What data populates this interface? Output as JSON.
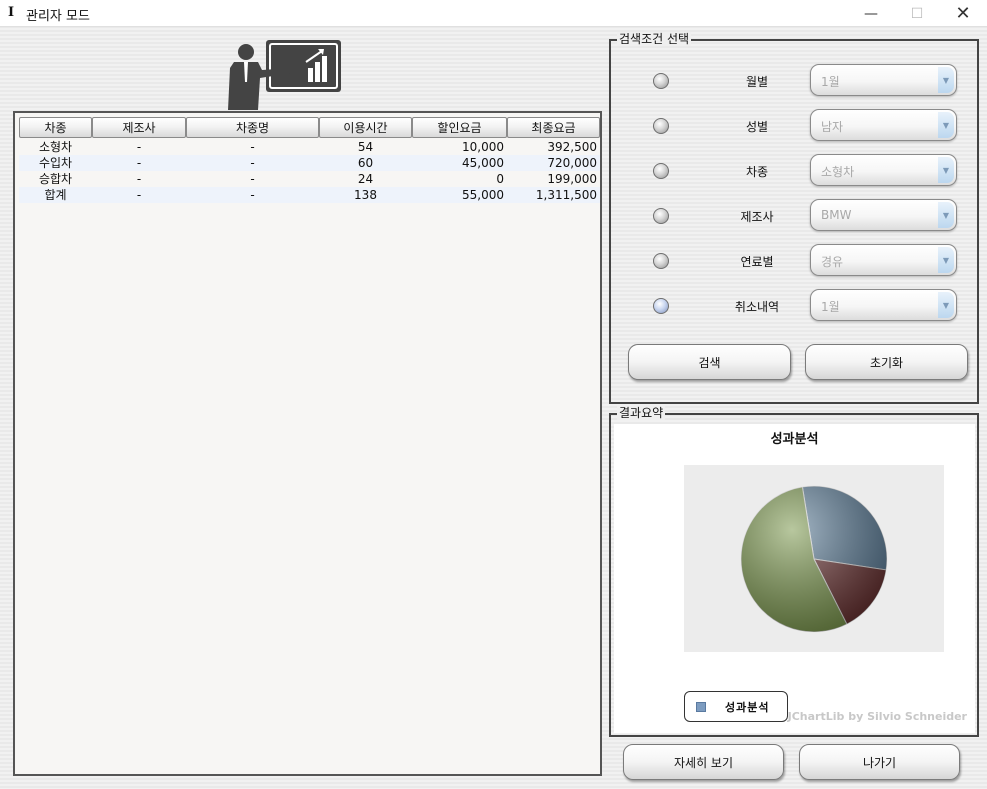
{
  "window": {
    "icon": "I",
    "title": "관리자 모드",
    "minimize_glyph": "—",
    "maximize_glyph": "☐",
    "close_glyph": "✕"
  },
  "table": {
    "headers": [
      "차종",
      "제조사",
      "차종명",
      "이용시간",
      "할인요금",
      "최종요금"
    ],
    "rows": [
      [
        "소형차",
        "-",
        "-",
        "54",
        "10,000",
        "392,500"
      ],
      [
        "수입차",
        "-",
        "-",
        "60",
        "45,000",
        "720,000"
      ],
      [
        "승합차",
        "-",
        "-",
        "24",
        "0",
        "199,000"
      ],
      [
        "합계",
        "-",
        "-",
        "138",
        "55,000",
        "1,311,500"
      ]
    ]
  },
  "search": {
    "group_label": "검색조건 선택",
    "criteria": [
      {
        "label": "월별",
        "value": "1월"
      },
      {
        "label": "성별",
        "value": "남자"
      },
      {
        "label": "차종",
        "value": "소형차"
      },
      {
        "label": "제조사",
        "value": "BMW"
      },
      {
        "label": "연료별",
        "value": "경유"
      },
      {
        "label": "취소내역",
        "value": "1월"
      }
    ],
    "selected_index": 5,
    "search_button": "검색",
    "reset_button": "초기화"
  },
  "result": {
    "group_label": "결과요약",
    "legend": "성과분석",
    "watermark": "JChartLib by Silvio Schneider"
  },
  "chart_data": {
    "type": "pie",
    "title": "성과분석",
    "slices": [
      {
        "value": 392500,
        "color": "#5e7f9a"
      },
      {
        "value": 199000,
        "color": "#6b3434"
      },
      {
        "value": 720000,
        "color": "#7e9a50"
      }
    ],
    "legend": [
      "성과분석"
    ]
  },
  "footer": {
    "detail_button": "자세히 보기",
    "exit_button": "나가기"
  }
}
